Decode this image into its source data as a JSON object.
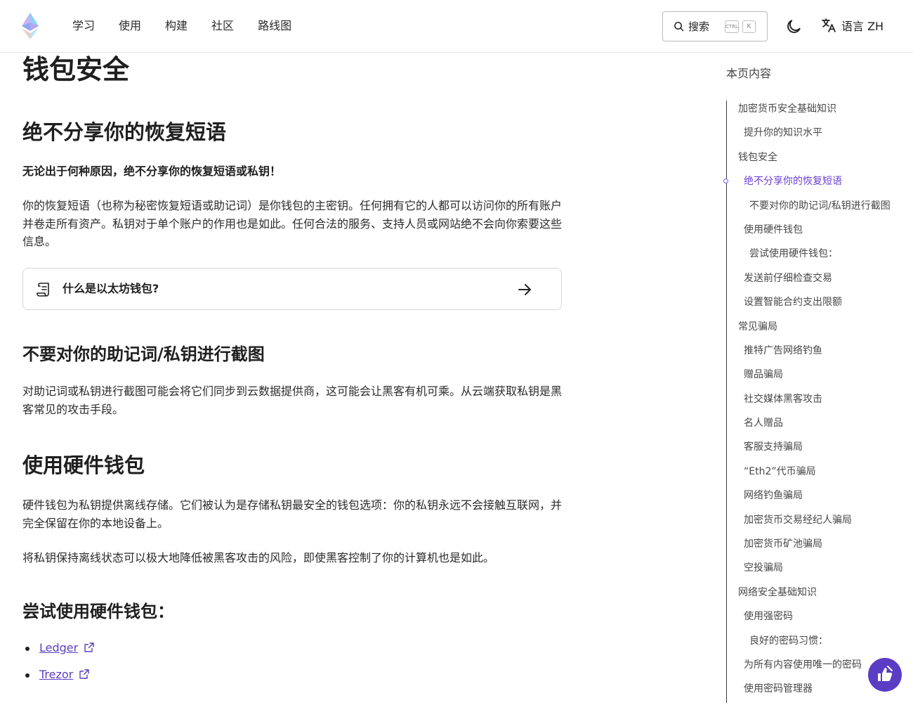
{
  "header": {
    "nav": [
      "学习",
      "使用",
      "构建",
      "社区",
      "路线图"
    ],
    "search": {
      "label": "搜索",
      "shortcut_ctrl": "CTRL",
      "shortcut_key": "K"
    },
    "language": {
      "label": "语言 ZH"
    }
  },
  "article": {
    "title": "钱包安全",
    "sections": [
      {
        "heading": "绝不分享你的恢复短语"
      },
      {
        "heading": "不要对你的助记词/私钥进行截图"
      },
      {
        "heading": "使用硬件钱包"
      },
      {
        "heading": "尝试使用硬件钱包："
      }
    ],
    "warning": "无论出于何种原因，绝不分享你的恢复短语或私钥！",
    "p1": "你的恢复短语（也称为秘密恢复短语或助记词）是你钱包的主密钥。任何拥有它的人都可以访问你的所有账户并卷走所有资产。私钥对于单个账户的作用也是如此。任何合法的服务、支持人员或网站绝不会向你索要这些信息。",
    "card_label": "什么是以太坊钱包?",
    "p2": "对助记词或私钥进行截图可能会将它们同步到云数据提供商，这可能会让黑客有机可乘。从云端获取私钥是黑客常见的攻击手段。",
    "p3": "硬件钱包为私钥提供离线存储。它们被认为是存储私钥最安全的钱包选项：你的私钥永远不会接触互联网，并完全保留在你的本地设备上。",
    "p4": "将私钥保持离线状态可以极大地降低被黑客攻击的风险，即使黑客控制了你的计算机也是如此。",
    "links": [
      "Ledger",
      "Trezor"
    ]
  },
  "toc": {
    "title": "本页内容",
    "items": [
      {
        "label": "加密货币安全基础知识",
        "level": 1
      },
      {
        "label": "提升你的知识水平",
        "level": 2
      },
      {
        "label": "钱包安全",
        "level": 1
      },
      {
        "label": "绝不分享你的恢复短语",
        "level": 2,
        "active": true
      },
      {
        "label": "不要对你的助记词/私钥进行截图",
        "level": 3
      },
      {
        "label": "使用硬件钱包",
        "level": 2
      },
      {
        "label": "尝试使用硬件钱包：",
        "level": 3
      },
      {
        "label": "发送前仔细检查交易",
        "level": 2
      },
      {
        "label": "设置智能合约支出限额",
        "level": 2
      },
      {
        "label": "常见骗局",
        "level": 1
      },
      {
        "label": "推特广告网络钓鱼",
        "level": 2
      },
      {
        "label": "赠品骗局",
        "level": 2
      },
      {
        "label": "社交媒体黑客攻击",
        "level": 2
      },
      {
        "label": "名人赠品",
        "level": 2
      },
      {
        "label": "客服支持骗局",
        "level": 2
      },
      {
        "label": "“Eth2”代币骗局",
        "level": 2
      },
      {
        "label": "网络钓鱼骗局",
        "level": 2
      },
      {
        "label": "加密货币交易经纪人骗局",
        "level": 2
      },
      {
        "label": "加密货币矿池骗局",
        "level": 2
      },
      {
        "label": "空投骗局",
        "level": 2
      },
      {
        "label": "网络安全基础知识",
        "level": 1
      },
      {
        "label": "使用强密码",
        "level": 2
      },
      {
        "label": "良好的密码习惯：",
        "level": 3
      },
      {
        "label": "为所有内容使用唯一的密码",
        "level": 2
      },
      {
        "label": "使用密码管理器",
        "level": 2
      }
    ]
  },
  "colors": {
    "accent": "#6b3fd4",
    "feedback_bg": "#5b3cc4",
    "link": "#5a3fc0"
  },
  "icons": [
    "ethereum-logo",
    "search-icon",
    "moon-icon",
    "translate-icon",
    "scroll-icon",
    "arrow-right-icon",
    "external-link-icon",
    "feedback-icon"
  ]
}
